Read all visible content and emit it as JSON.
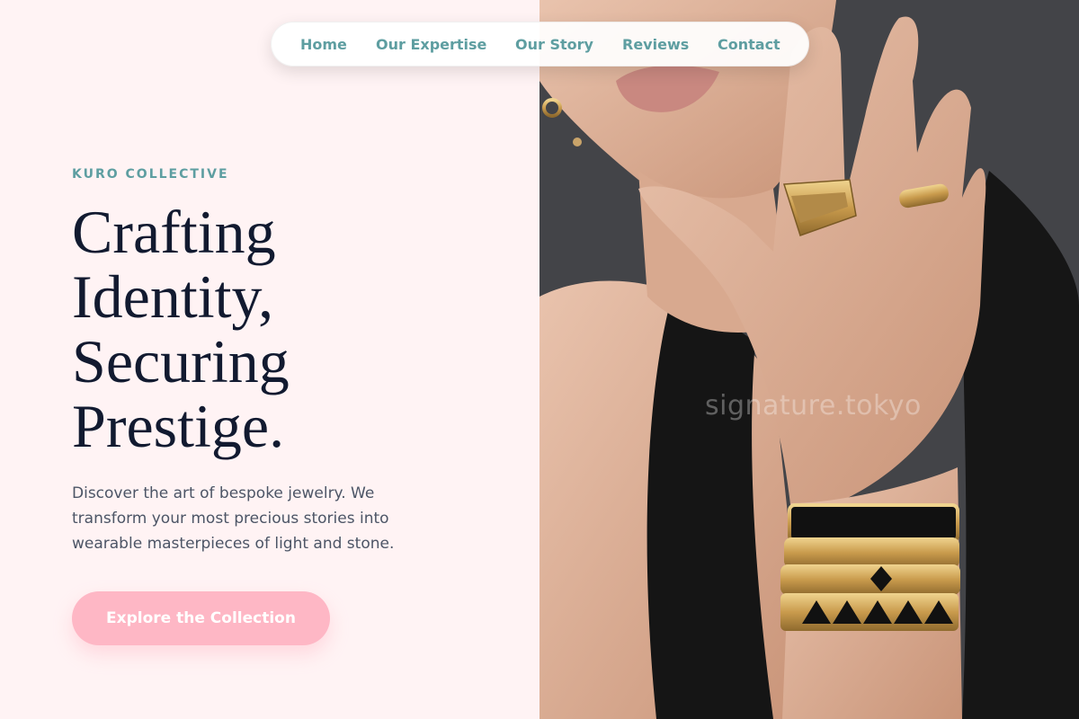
{
  "nav": {
    "items": [
      {
        "label": "Home"
      },
      {
        "label": "Our Expertise"
      },
      {
        "label": "Our Story"
      },
      {
        "label": "Reviews"
      },
      {
        "label": "Contact"
      }
    ]
  },
  "hero": {
    "eyebrow": "KURO COLLECTIVE",
    "headline_lines": [
      "Crafting",
      "Identity,",
      "Securing",
      "Prestige."
    ],
    "description": "Discover the art of bespoke jewelry. We transform your most precious stories into wearable masterpieces of light and stone.",
    "cta_label": "Explore the Collection"
  },
  "image": {
    "watermark": "signature.tokyo",
    "subject": "model-wearing-gold-rings-and-bracelets"
  },
  "colors": {
    "background": "#fff3f4",
    "accent_teal": "#5e9ea1",
    "headline": "#121a30",
    "cta": "#feb7c5"
  }
}
